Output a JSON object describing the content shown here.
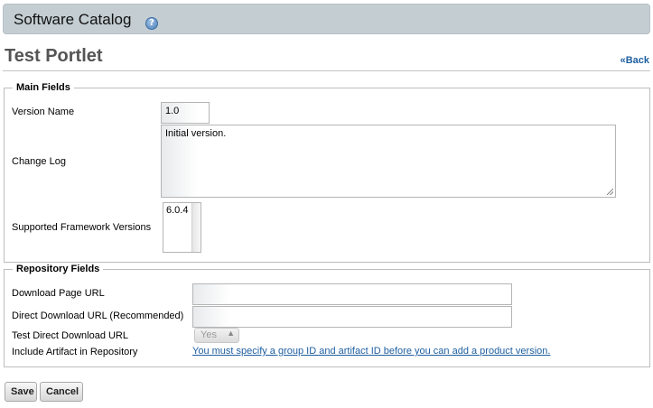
{
  "header": {
    "title": "Software Catalog",
    "help_icon": "help-icon"
  },
  "page": {
    "title": "Test Portlet",
    "back_label": "«Back"
  },
  "main_fields": {
    "legend": "Main Fields",
    "version_name_label": "Version Name",
    "version_name_value": "1.0",
    "change_log_label": "Change Log",
    "change_log_value": "Initial version.",
    "framework_label": "Supported Framework Versions",
    "framework_options": [
      "6.0.4"
    ]
  },
  "repository_fields": {
    "legend": "Repository Fields",
    "download_page_label": "Download Page URL",
    "download_page_value": "",
    "direct_download_label": "Direct Download URL (Recommended)",
    "direct_download_value": "",
    "test_direct_label": "Test Direct Download URL",
    "test_direct_value": "Yes",
    "include_artifact_label": "Include Artifact in Repository",
    "include_artifact_message": "You must specify a group ID and artifact ID before you can add a product version."
  },
  "actions": {
    "save_label": "Save",
    "cancel_label": "Cancel"
  }
}
